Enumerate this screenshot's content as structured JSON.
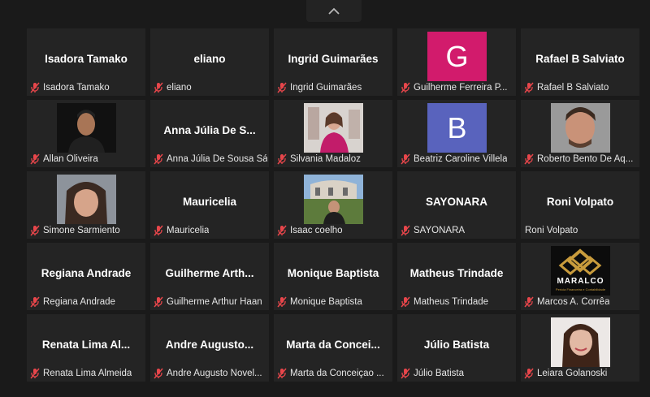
{
  "toolbar": {
    "toggle_icon": "chevron-up-icon"
  },
  "colors": {
    "muted": "#e8464b",
    "tile": "#242424",
    "bg": "#1a1a1a",
    "avatar_g": "#d21b6c",
    "avatar_b": "#5963bd"
  },
  "tiles": [
    {
      "name": "Isadora Tamako",
      "label": "Isadora Tamako",
      "muted": true
    },
    {
      "name": "eliano",
      "label": "eliano",
      "muted": true
    },
    {
      "name": "Ingrid Guimarães",
      "label": "Ingrid Guimarães",
      "muted": true
    },
    {
      "avatar_letter": "G",
      "label": "Guilherme Ferreira P...",
      "muted": true
    },
    {
      "name": "Rafael B Salviato",
      "label": "Rafael B Salviato",
      "muted": true
    },
    {
      "label": "Allan Oliveira",
      "muted": true
    },
    {
      "name": "Anna Júlia De S...",
      "label": "Anna Júlia De Sousa Sá",
      "muted": true
    },
    {
      "label": "Silvania Madaloz",
      "muted": true
    },
    {
      "avatar_letter": "B",
      "label": "Beatriz Caroline Villela",
      "muted": true
    },
    {
      "label": "Roberto Bento De Aq...",
      "muted": true
    },
    {
      "label": "Simone Sarmiento",
      "muted": true
    },
    {
      "name": "Mauricelia",
      "label": "Mauricelia",
      "muted": true
    },
    {
      "label": "Isaac coelho",
      "muted": true
    },
    {
      "name": "SAYONARA",
      "label": "SAYONARA",
      "muted": true
    },
    {
      "name": "Roni Volpato",
      "label": "Roni Volpato",
      "muted": false
    },
    {
      "name": "Regiana Andrade",
      "label": "Regiana Andrade",
      "muted": true
    },
    {
      "name": "Guilherme Arth...",
      "label": "Guilherme Arthur Haan",
      "muted": true
    },
    {
      "name": "Monique Baptista",
      "label": "Monique Baptista",
      "muted": true
    },
    {
      "name": "Matheus Trindade",
      "label": "Matheus Trindade",
      "muted": true
    },
    {
      "logo_text": "MARALCO",
      "logo_sub": "Perícia Financeira e Contabilidade",
      "label": "Marcos A. Corrêa",
      "muted": true
    },
    {
      "name": "Renata Lima Al...",
      "label": "Renata Lima Almeida",
      "muted": true
    },
    {
      "name": "Andre Augusto...",
      "label": "Andre Augusto Novel...",
      "muted": true
    },
    {
      "name": "Marta da Concei...",
      "label": "Marta da Conceiçao ...",
      "muted": true
    },
    {
      "name": "Júlio Batista",
      "label": "Júlio Batista",
      "muted": true
    },
    {
      "label": "Leiara Golanoski",
      "muted": true
    }
  ]
}
